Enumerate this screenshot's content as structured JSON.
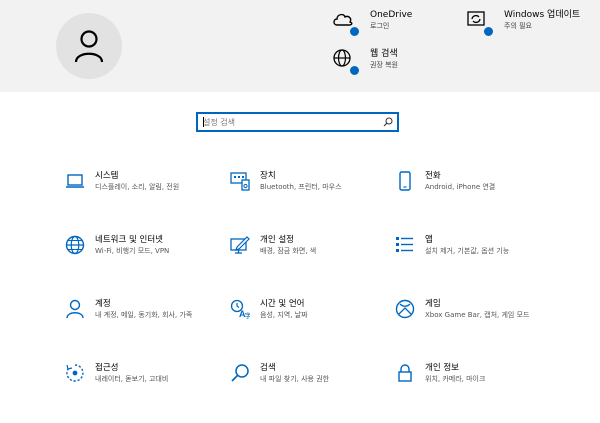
{
  "status": {
    "onedrive": {
      "title": "OneDrive",
      "subtitle": "로그인"
    },
    "windows_update": {
      "title": "Windows 업데이트",
      "subtitle": "주의 필요"
    },
    "web_search": {
      "title": "웹 검색",
      "subtitle": "권장 복원"
    }
  },
  "search": {
    "placeholder": "설정 검색",
    "value": ""
  },
  "tiles": [
    {
      "title": "시스템",
      "desc": "디스플레이, 소리, 알림, 전원",
      "icon": "laptop-icon"
    },
    {
      "title": "장치",
      "desc": "Bluetooth, 프린터, 마우스",
      "icon": "keyboard-icon"
    },
    {
      "title": "전화",
      "desc": "Android, iPhone 연결",
      "icon": "phone-icon"
    },
    {
      "title": "네트워크 및 인터넷",
      "desc": "Wi-Fi, 비행기 모드, VPN",
      "icon": "globe-icon"
    },
    {
      "title": "개인 설정",
      "desc": "배경, 잠금 화면, 색",
      "icon": "pen-screen-icon"
    },
    {
      "title": "앱",
      "desc": "설치 제거, 기본값, 옵션 기능",
      "icon": "apps-list-icon"
    },
    {
      "title": "계정",
      "desc": "내 계정, 메일, 동기화, 회사, 가족",
      "icon": "person-icon"
    },
    {
      "title": "시간 및 언어",
      "desc": "음성, 지역, 날짜",
      "icon": "time-language-icon"
    },
    {
      "title": "게임",
      "desc": "Xbox Game Bar, 캡처, 게임 모드",
      "icon": "xbox-icon"
    },
    {
      "title": "접근성",
      "desc": "내레이터, 돋보기, 고대비",
      "icon": "accessibility-icon"
    },
    {
      "title": "검색",
      "desc": "내 파일 찾기, 사용 권한",
      "icon": "search-icon"
    },
    {
      "title": "개인 정보",
      "desc": "위치, 카메라, 마이크",
      "icon": "lock-icon"
    }
  ],
  "colors": {
    "accent": "#0067c0",
    "banner": "#f2f2f2",
    "avatar_bg": "#e2e2e2"
  }
}
